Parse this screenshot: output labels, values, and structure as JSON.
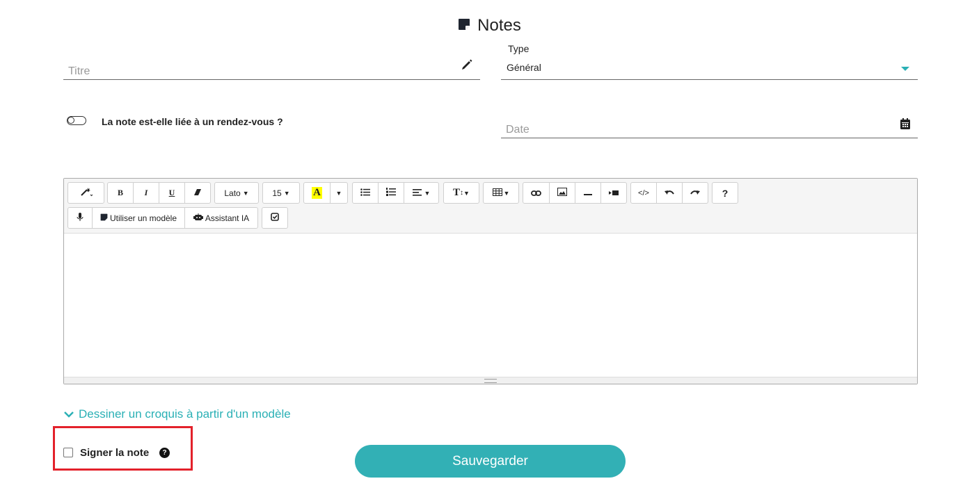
{
  "header": {
    "title": "Notes",
    "icon": "sticky-note-icon"
  },
  "form": {
    "title_placeholder": "Titre",
    "type_label": "Type",
    "type_value": "Général",
    "appointment_toggle_label": "La note est-elle liée à un rendez-vous ?",
    "date_placeholder": "Date"
  },
  "toolbar": {
    "font_name": "Lato",
    "font_size": "15",
    "bold": "B",
    "italic": "I",
    "underline": "U",
    "highlight_letter": "A",
    "text_height": "T",
    "code": "</>",
    "help": "?",
    "use_template": "Utiliser un modèle",
    "ai_assistant": "Assistant IA"
  },
  "sketch_link": "Dessiner un croquis à partir d'un modèle",
  "sign": {
    "label": "Signer la note",
    "help": "?"
  },
  "save_button": "Sauvegarder",
  "colors": {
    "accent": "#32b0b5",
    "highlight_box": "#e3212b",
    "highlight_yellow": "#ffff00"
  }
}
